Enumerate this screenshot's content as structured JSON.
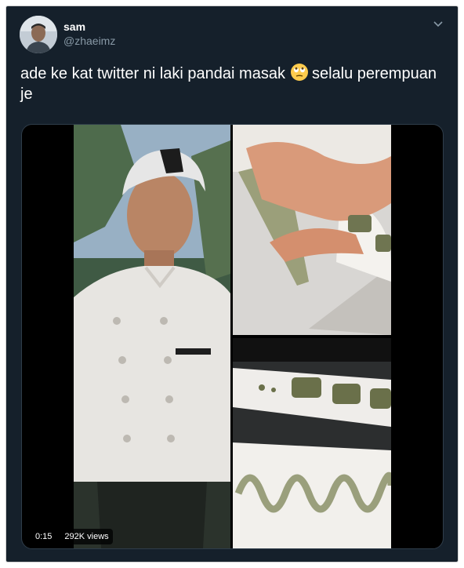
{
  "tweet": {
    "display_name": "sam",
    "handle": "@zhaeimz",
    "text_part1": "ade ke kat twitter ni laki pandai masak",
    "emoji": "rolling-eyes-emoji",
    "text_part2": "selalu perempuan je"
  },
  "header": {
    "menu_icon": "chevron-down-icon"
  },
  "media": {
    "duration": "0:15",
    "views": "292K views"
  },
  "colors": {
    "background": "#15202b",
    "text": "#ffffff",
    "muted": "#8899a6"
  }
}
